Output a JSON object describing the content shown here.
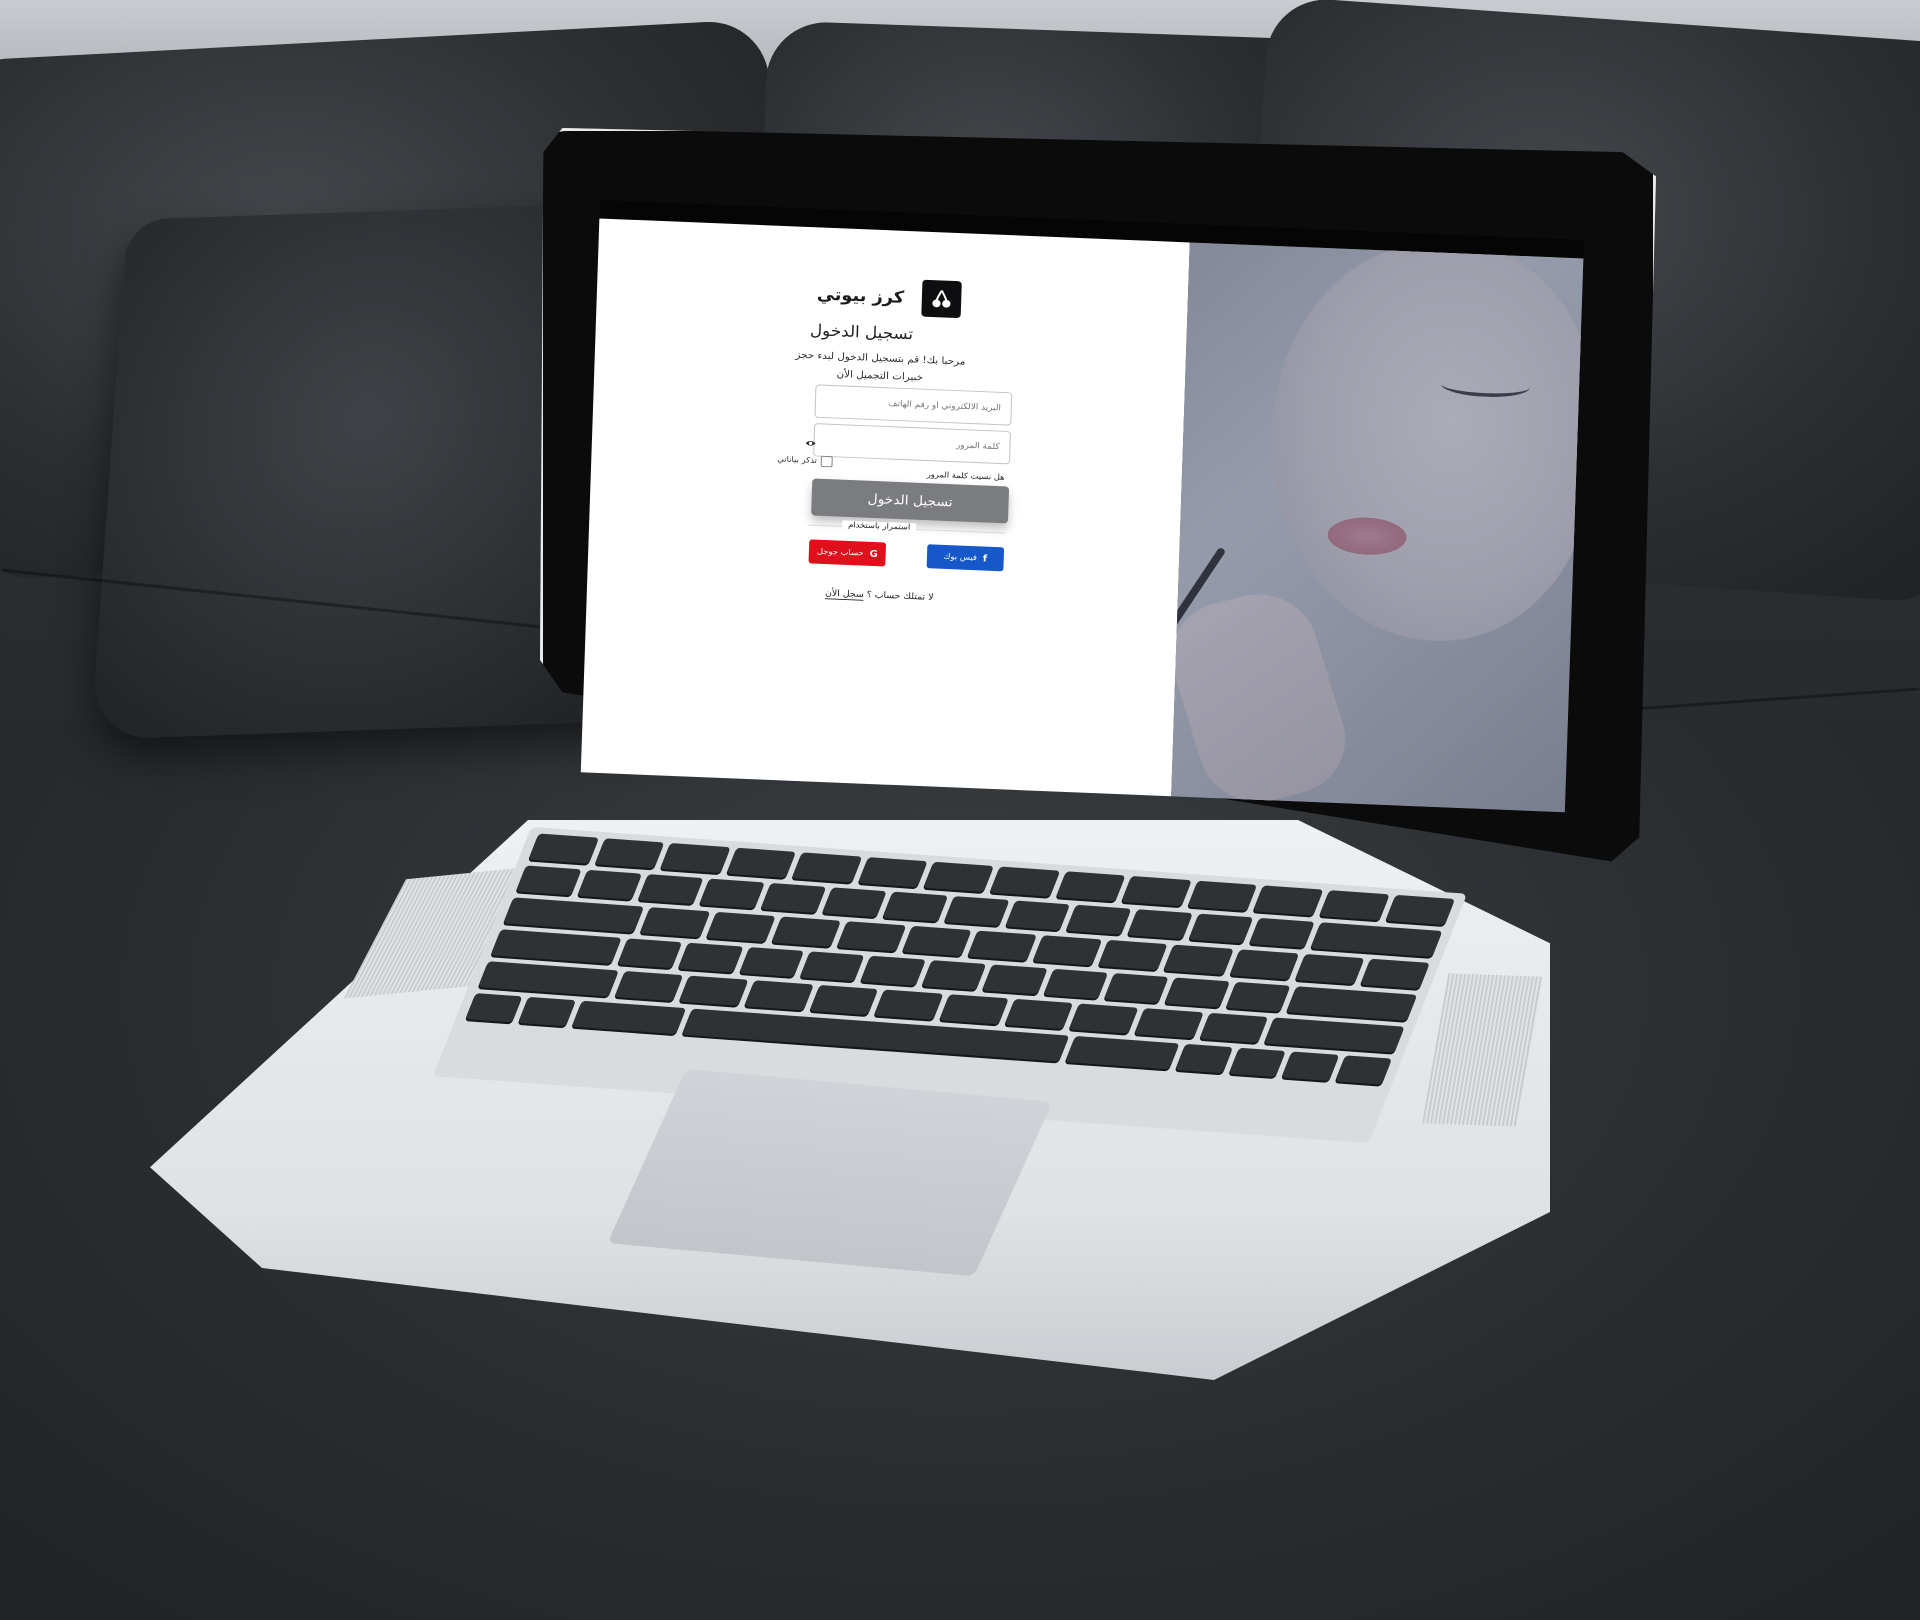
{
  "brand": {
    "name": "كرز بيوتي",
    "logo_icon": "cherry-icon"
  },
  "login": {
    "title": "تسجيل الدخول",
    "welcome": "مرحبا بك! قم بتسجيل الدخول لبدء حجز خبيرات التجميل الأن",
    "email_placeholder": "البريد الالكتروني أو رقم الهاتف",
    "password_placeholder": "كلمة المرور",
    "remember_label": "تذكر بياناتي",
    "forgot_label": "هل نسيت كلمة المرور",
    "submit_label": "تسجيل الدخول",
    "continue_with": "استمرار باستخدام",
    "facebook_label": "فيس بوك",
    "google_label": "حساب جوجل",
    "no_account": "لا تمتلك حساب ؟",
    "signup_link": "سجل الأن"
  },
  "colors": {
    "facebook": "#1658c9",
    "google": "#df0f1b",
    "submit": "#7a7c7f"
  }
}
